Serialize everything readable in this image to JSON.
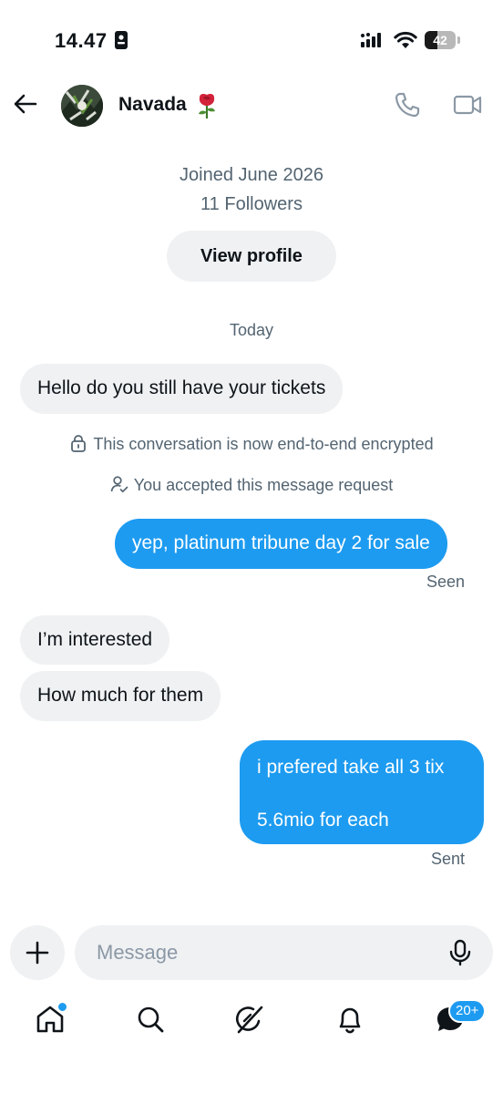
{
  "status_bar": {
    "time": "14.47",
    "battery_level": "42",
    "battery_fraction": 0.42
  },
  "header": {
    "contact_name": "Navada",
    "name_emoji_icon": "rose-icon",
    "back_icon": "arrow-left-icon",
    "call_icon": "phone-icon",
    "video_icon": "video-camera-icon"
  },
  "profile": {
    "joined": "Joined June 2026",
    "followers": "11 Followers",
    "view_profile_label": "View profile"
  },
  "conversation": {
    "date_label": "Today",
    "messages": [
      {
        "direction": "incoming",
        "text": "Hello do you still have your tickets"
      },
      {
        "direction": "outgoing",
        "text": "yep, platinum tribune day 2 for sale"
      },
      {
        "direction": "incoming",
        "text": "I’m interested"
      },
      {
        "direction": "incoming",
        "text": "How much for them"
      },
      {
        "direction": "outgoing",
        "lines": [
          "i prefered take all 3 tix",
          "5.6mio for each"
        ]
      }
    ],
    "system": {
      "encrypted": "This conversation is now end-to-end encrypted",
      "accepted": "You accepted this message request"
    },
    "receipts": {
      "seen": "Seen",
      "sent": "Sent"
    }
  },
  "composer": {
    "placeholder": "Message",
    "add_icon": "plus-icon",
    "mic_icon": "microphone-icon"
  },
  "bottom_nav": {
    "items": [
      {
        "id": "home",
        "icon": "home-icon",
        "has_dot": true
      },
      {
        "id": "search",
        "icon": "search-icon"
      },
      {
        "id": "grok",
        "icon": "grok-icon"
      },
      {
        "id": "notifications",
        "icon": "bell-icon"
      },
      {
        "id": "messages",
        "icon": "messages-icon",
        "badge": "20+"
      }
    ]
  },
  "colors": {
    "accent": "#1d9bf0",
    "bubble_incoming": "#eff1f3",
    "muted_text": "#536471"
  }
}
